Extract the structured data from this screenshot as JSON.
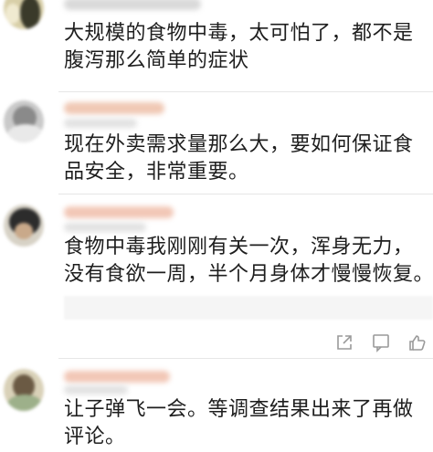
{
  "comments": [
    {
      "lines": [
        "大规模的食物中毒，太可怕了，都不是",
        "腹泻那么简单的症状"
      ]
    },
    {
      "lines": [
        "现在外卖需求量那么大，要如何保证食",
        "品安全，非常重要。"
      ]
    },
    {
      "lines": [
        "食物中毒我刚刚有关一次，浑身无力，",
        "没有食欲一周，半个月身体才慢慢恢复。"
      ]
    },
    {
      "lines": [
        "让子弹飞一会。等调查结果出来了再做",
        "评论。"
      ]
    }
  ],
  "actions": [
    {
      "icon": "share-icon"
    },
    {
      "icon": "comment-icon"
    },
    {
      "icon": "like-icon"
    }
  ],
  "colors": {
    "text": "#1e1e1e",
    "icon": "#9a9a9a",
    "divider": "#e6e6e6"
  }
}
